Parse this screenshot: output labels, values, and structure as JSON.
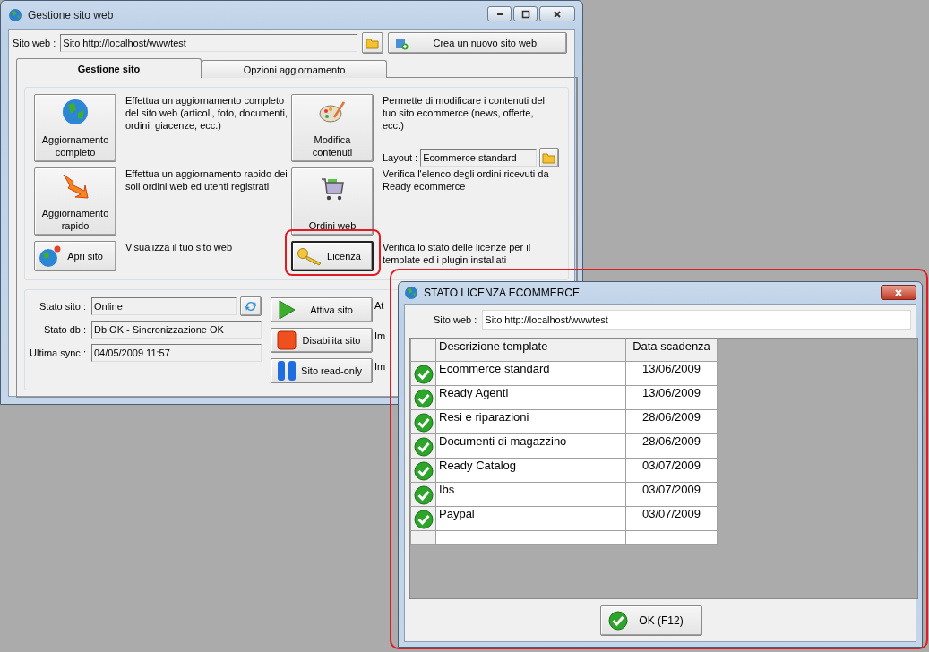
{
  "main_window": {
    "title": "Gestione sito web",
    "site_label": "Sito web :",
    "site_value": "Sito http://localhost/wwwtest",
    "new_site_button": "Crea un nuovo sito web",
    "tabs": [
      {
        "label": "Gestione sito",
        "selected": true
      },
      {
        "label": "Opzioni aggiornamento",
        "selected": false
      }
    ],
    "actions": [
      {
        "label": "Aggiornamento completo",
        "description": "Effettua un aggiornamento completo del sito web (articoli, foto, documenti, ordini, giacenze, ecc.)",
        "highlighted": false
      },
      {
        "label": "Modifica contenuti",
        "description": "Permette di modificare i contenuti del tuo sito ecommerce (news, offerte, ecc.)",
        "highlighted": false,
        "layout": {
          "label": "Layout :",
          "value": "Ecommerce standard"
        }
      },
      {
        "label": "Aggiornamento rapido",
        "description": "Effettua un aggiornamento rapido dei soli ordini web ed utenti registrati",
        "highlighted": false
      },
      {
        "label": "Ordini web",
        "description": "Verifica l'elenco degli ordini ricevuti da Ready ecommerce",
        "highlighted": false
      },
      {
        "label": "Apri sito",
        "description": "Visualizza il tuo sito web",
        "highlighted": false
      },
      {
        "label": "Licenza",
        "description": "Verifica lo stato delle licenze per il template ed i plugin installati",
        "highlighted": true
      }
    ],
    "status_fields": [
      {
        "label": "Stato sito :",
        "value": "Online"
      },
      {
        "label": "Stato db :",
        "value": "Db OK - Sincronizzazione OK"
      },
      {
        "label": "Ultima sync :",
        "value": "04/05/2009 11:57"
      }
    ],
    "site_buttons": [
      {
        "kind": "play",
        "label": "Attiva sito",
        "note": "At"
      },
      {
        "kind": "stop",
        "label": "Disabilita sito",
        "note": "Im"
      },
      {
        "kind": "pause",
        "label": "Sito read-only",
        "note": "Im"
      }
    ]
  },
  "dialog": {
    "title": "STATO LICENZA ECOMMERCE",
    "highlighted": true,
    "site_label": "Sito web :",
    "site_value": "Sito http://localhost/wwwtest",
    "columns": [
      "Descrizione template",
      "Data scadenza"
    ],
    "rows": [
      {
        "valid": true,
        "name": "Ecommerce standard",
        "date": "13/06/2009"
      },
      {
        "valid": true,
        "name": "Ready Agenti",
        "date": "13/06/2009"
      },
      {
        "valid": true,
        "name": "Resi e riparazioni",
        "date": "28/06/2009"
      },
      {
        "valid": true,
        "name": "Documenti di magazzino",
        "date": "28/06/2009"
      },
      {
        "valid": true,
        "name": "Ready Catalog",
        "date": "03/07/2009"
      },
      {
        "valid": true,
        "name": "Ibs",
        "date": "03/07/2009"
      },
      {
        "valid": true,
        "name": "Paypal",
        "date": "03/07/2009"
      }
    ],
    "ok_button": "OK (F12)"
  }
}
